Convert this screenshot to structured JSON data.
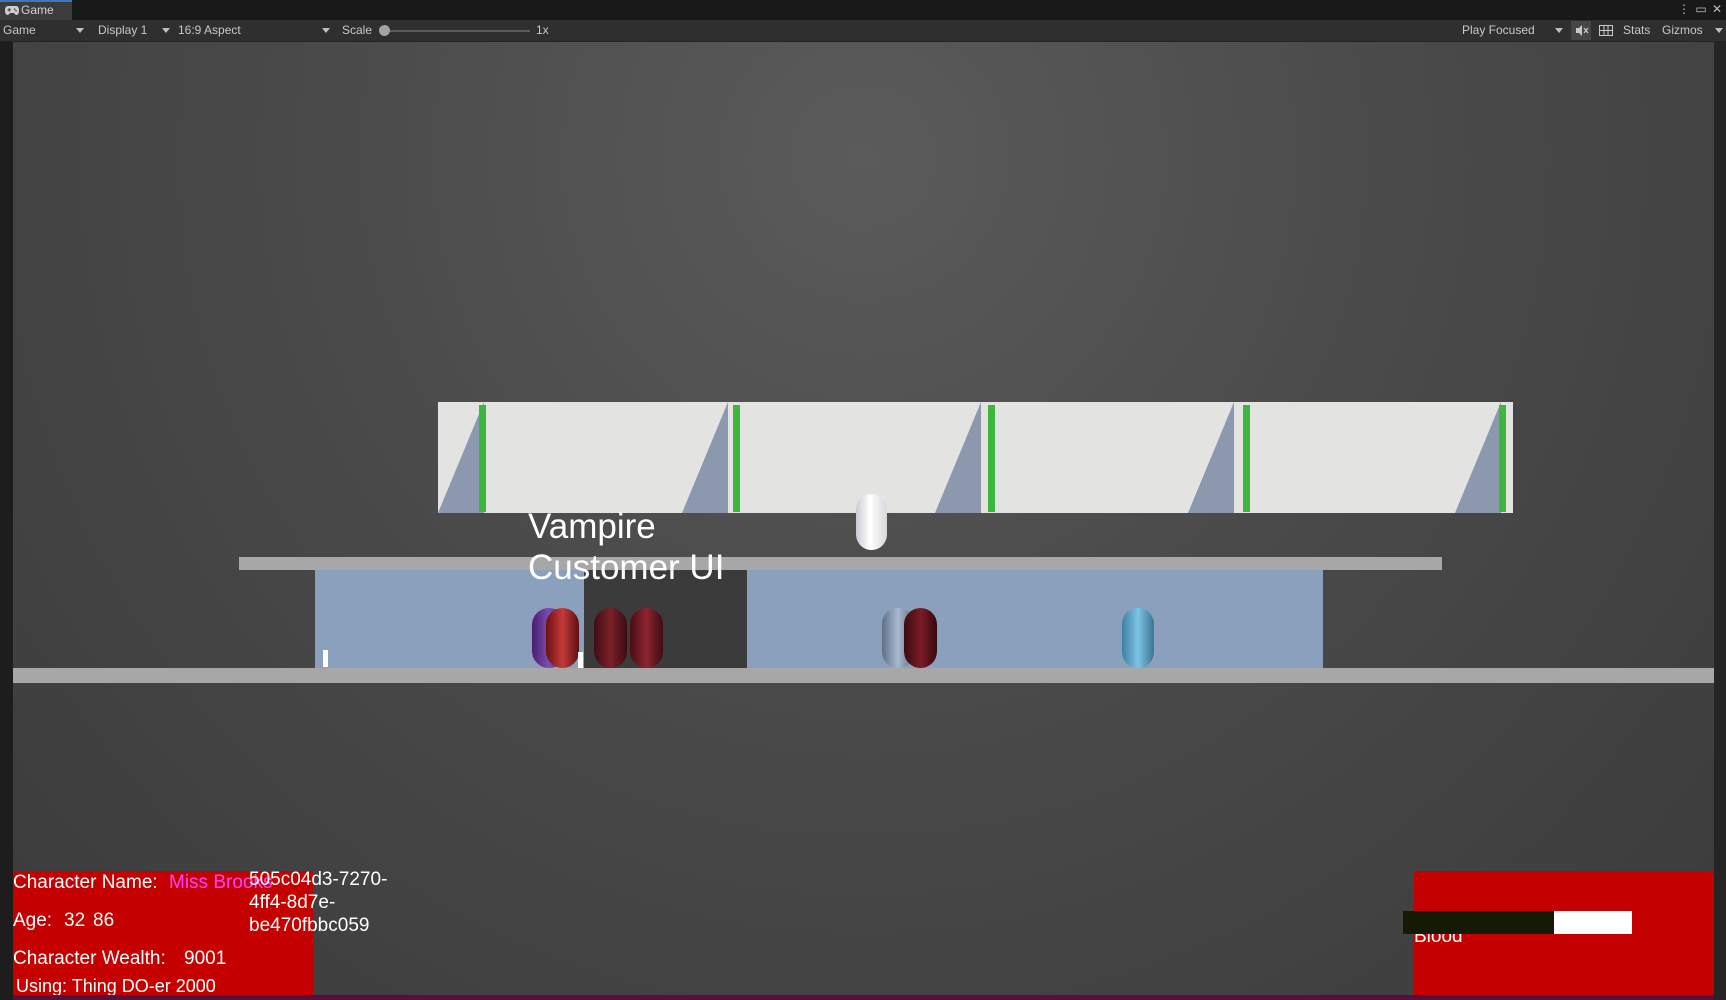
{
  "window": {
    "tab_label": "Game",
    "controls": {
      "more": "⋮",
      "maximize": "▭",
      "close": "✕"
    }
  },
  "toolbar": {
    "view_select": "Game",
    "display_select": "Display 1",
    "aspect_select": "16:9 Aspect",
    "scale_label": "Scale",
    "scale_value": "1x",
    "scale_fraction": 0.0,
    "play_mode_select": "Play Focused",
    "mute_icon": "speaker-off-icon",
    "grid_icon": "grid-icon",
    "stats_label": "Stats",
    "gizmos_label": "Gizmos"
  },
  "scene": {
    "world_label": "Vampire Customer UI",
    "colors": {
      "background": "#4a4a4a",
      "wall": "#e3e4e1",
      "post": "#3cb63c",
      "room": "#8ba0bc",
      "shelf": "#a7a7a7"
    }
  },
  "character_panel": {
    "name_label": "Character Name:",
    "name_value": "Miss Brooks",
    "name_color": "#ff44ff",
    "age_label": "Age:",
    "age_value": "32",
    "age_extra": "86",
    "wealth_label": "Character Wealth:",
    "wealth_value": "9001",
    "using_text": "Using: Thing DO-er 2000",
    "guid_lines": [
      "505c04d3-7270-",
      "4ff4-8d7e-",
      "be470fbbc059"
    ],
    "panel_color": "#c50000"
  },
  "blood_panel": {
    "label": "Blood",
    "bar_fill_fraction": 0.34,
    "panel_color": "#c50000"
  }
}
